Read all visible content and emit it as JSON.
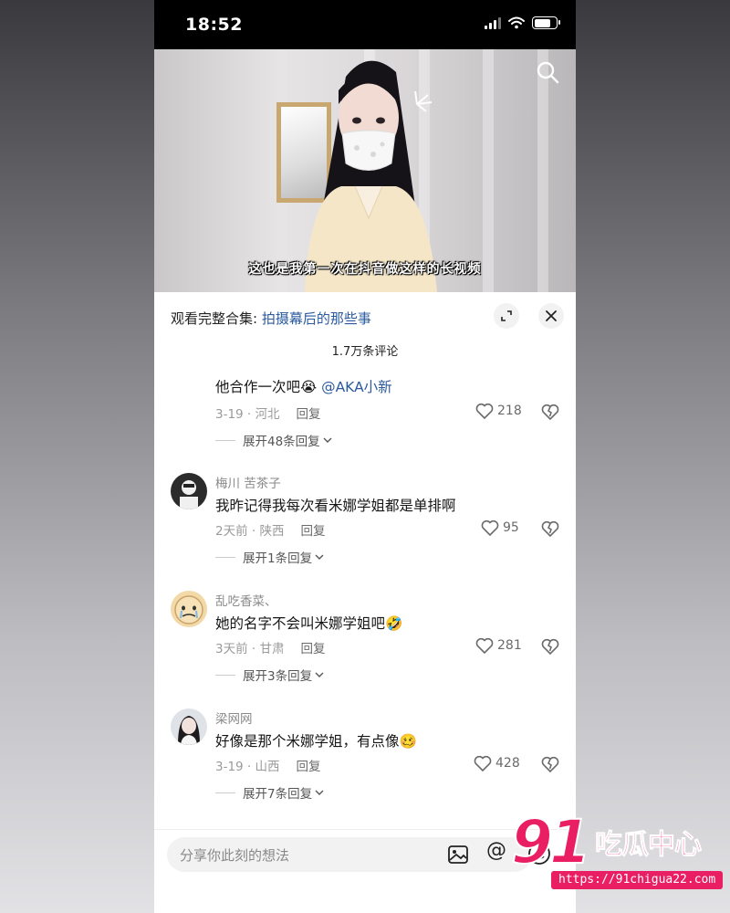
{
  "status_bar": {
    "time": "18:52",
    "battery_level": 0.75
  },
  "video": {
    "caption": "这也是我第一次在抖音做这样的长视频"
  },
  "panel": {
    "collection_prefix": "观看完整合集:",
    "collection_link": "拍摄幕后的那些事",
    "comment_count": "1.7万条评论"
  },
  "comments": [
    {
      "user": "",
      "text": "他合作一次吧",
      "emoji": "😭",
      "mention": "@AKA小新",
      "meta": "3-19 · 河北",
      "reply": "回复",
      "likes": "218",
      "expand": "展开48条回复"
    },
    {
      "user": "梅川 苦茶子",
      "text": "我昨记得我每次看米娜学姐都是单排啊",
      "emoji": "",
      "mention": "",
      "meta": "2天前 · 陕西",
      "reply": "回复",
      "likes": "95",
      "expand": "展开1条回复"
    },
    {
      "user": "乱吃香菜、",
      "text": "她的名字不会叫米娜学姐吧",
      "emoji": "🤣",
      "mention": "",
      "meta": "3天前 · 甘肃",
      "reply": "回复",
      "likes": "281",
      "expand": "展开3条回复"
    },
    {
      "user": "梁网网",
      "text": "好像是那个米娜学姐，有点像",
      "emoji": "🥴",
      "mention": "",
      "meta": "3-19 · 山西",
      "reply": "回复",
      "likes": "428",
      "expand": "展开7条回复"
    }
  ],
  "input": {
    "placeholder": "分享你此刻的想法",
    "at_symbol": "@"
  },
  "watermark": {
    "number": "91",
    "brand": "吃瓜中心",
    "url": "https://91chigua22.com"
  },
  "colors": {
    "accent_link": "#2b5a9e",
    "watermark": "#e91e63"
  }
}
